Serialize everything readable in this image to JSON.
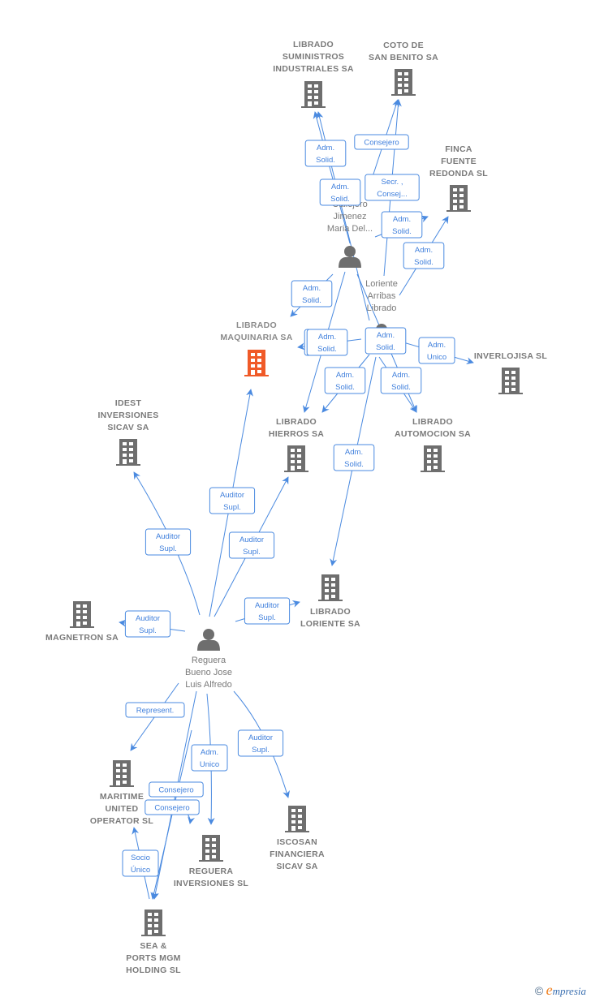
{
  "colors": {
    "edge": "#4a8ae0",
    "node_icon": "#6e6e6e",
    "highlight_icon": "#f05a28",
    "label_text": "#7a7a7a",
    "edge_text": "#3f7fdc"
  },
  "nodes": [
    {
      "id": "suministros",
      "type": "company",
      "label": [
        "LIBRADO",
        "SUMINISTROS",
        "INDUSTRIALES SA"
      ]
    },
    {
      "id": "coto",
      "type": "company",
      "label": [
        "COTO DE",
        "SAN BENITO SA"
      ]
    },
    {
      "id": "finca",
      "type": "company",
      "label": [
        "FINCA",
        "FUENTE",
        "REDONDA SL"
      ]
    },
    {
      "id": "callejero",
      "type": "person",
      "label": [
        "Callejero",
        "Jimenez",
        "Maria Del..."
      ]
    },
    {
      "id": "loriente_p",
      "type": "person",
      "label": [
        "Loriente",
        "Arribas",
        "Librado"
      ]
    },
    {
      "id": "maquinaria",
      "type": "company",
      "highlight": true,
      "label": [
        "LIBRADO",
        "MAQUINARIA SA"
      ]
    },
    {
      "id": "inverlojisa",
      "type": "company",
      "label": [
        "INVERLOJISA SL"
      ]
    },
    {
      "id": "idest",
      "type": "company",
      "label": [
        "IDEST",
        "INVERSIONES",
        "SICAV SA"
      ]
    },
    {
      "id": "hierros",
      "type": "company",
      "label": [
        "LIBRADO",
        "HIERROS SA"
      ]
    },
    {
      "id": "automocion",
      "type": "company",
      "label": [
        "LIBRADO",
        "AUTOMOCION SA"
      ]
    },
    {
      "id": "loriente_sa",
      "type": "company",
      "label": [
        "LIBRADO",
        "LORIENTE SA"
      ]
    },
    {
      "id": "magnetron",
      "type": "company",
      "label": [
        "MAGNETRON SA"
      ]
    },
    {
      "id": "reguera",
      "type": "person",
      "label": [
        "Reguera",
        "Bueno Jose",
        "Luis Alfredo"
      ]
    },
    {
      "id": "maritime",
      "type": "company",
      "label": [
        "MARITIME",
        "UNITED",
        "OPERATOR  SL"
      ]
    },
    {
      "id": "reguera_inv",
      "type": "company",
      "label": [
        "REGUERA",
        "INVERSIONES SL"
      ]
    },
    {
      "id": "iscosan",
      "type": "company",
      "label": [
        "ISCOSAN",
        "FINANCIERA",
        "SICAV SA"
      ]
    },
    {
      "id": "seaports",
      "type": "company",
      "label": [
        "SEA &",
        "PORTS MGM",
        "HOLDING  SL"
      ]
    }
  ],
  "edges": [
    {
      "from": "callejero",
      "to": "suministros",
      "label": [
        "Adm.",
        "Solid."
      ]
    },
    {
      "from": "loriente_p",
      "to": "suministros",
      "label": [
        "Adm.",
        "Solid."
      ]
    },
    {
      "from": "callejero",
      "to": "coto",
      "label": [
        "Consejero"
      ]
    },
    {
      "from": "loriente_p",
      "to": "coto",
      "label": [
        "Secr. ,",
        "Consej..."
      ]
    },
    {
      "from": "callejero",
      "to": "finca",
      "label": [
        "Adm.",
        "Solid."
      ]
    },
    {
      "from": "loriente_p",
      "to": "finca",
      "label": [
        "Adm.",
        "Solid."
      ]
    },
    {
      "from": "callejero",
      "to": "maquinaria",
      "label": [
        "Adm.",
        "Solid."
      ]
    },
    {
      "from": "loriente_p",
      "to": "maquinaria",
      "label": [
        "Adm.",
        "Solid."
      ]
    },
    {
      "from": "callejero",
      "to": "hierros",
      "label": [
        "Adm.",
        "Solid."
      ]
    },
    {
      "from": "loriente_p",
      "to": "inverlojisa",
      "label": [
        "Adm.",
        "Unico"
      ]
    },
    {
      "from": "loriente_p",
      "to": "hierros",
      "label": [
        "Adm.",
        "Solid."
      ]
    },
    {
      "from": "callejero",
      "to": "automocion",
      "label": [
        "Adm.",
        "Solid."
      ]
    },
    {
      "from": "loriente_p",
      "to": "automocion",
      "label": [
        "Adm.",
        "Solid."
      ]
    },
    {
      "from": "loriente_p",
      "to": "loriente_sa",
      "label": [
        "Adm.",
        "Solid."
      ]
    },
    {
      "from": "reguera",
      "to": "maquinaria",
      "label": [
        "Auditor",
        "Supl."
      ]
    },
    {
      "from": "reguera",
      "to": "idest",
      "label": [
        "Auditor",
        "Supl."
      ]
    },
    {
      "from": "reguera",
      "to": "hierros",
      "label": [
        "Auditor",
        "Supl."
      ]
    },
    {
      "from": "reguera",
      "to": "loriente_sa",
      "label": [
        "Auditor",
        "Supl."
      ]
    },
    {
      "from": "reguera",
      "to": "magnetron",
      "label": [
        "Auditor",
        "Supl."
      ]
    },
    {
      "from": "reguera",
      "to": "maritime",
      "label": [
        "Represent."
      ]
    },
    {
      "from": "reguera",
      "to": "reguera_inv",
      "label": [
        "Adm.",
        "Unico"
      ]
    },
    {
      "from": "reguera",
      "to": "iscosan",
      "label": [
        "Auditor",
        "Supl."
      ]
    },
    {
      "from": "reguera",
      "to": "seaports",
      "label": [
        "Consejero"
      ]
    },
    {
      "from": "reguera",
      "to": "seaports",
      "label": [
        "Consejero"
      ]
    },
    {
      "from": "seaports",
      "to": "maritime",
      "label": [
        "Socio",
        "Único"
      ]
    },
    {
      "from": "reguera",
      "to": "reguera_inv",
      "label": []
    }
  ],
  "credit": {
    "symbol": "©",
    "brand_initial": "e",
    "brand_rest": "mpresia"
  }
}
